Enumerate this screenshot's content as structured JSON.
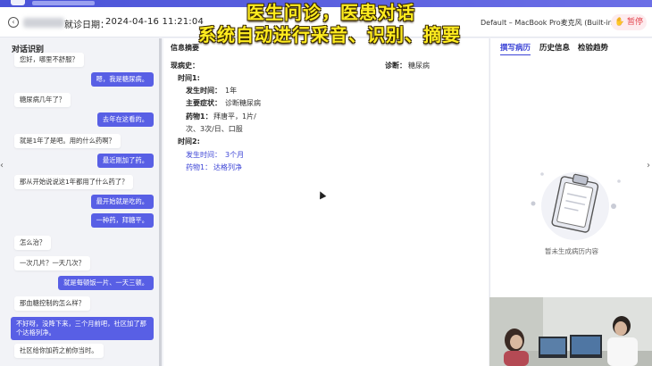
{
  "header": {
    "visit_date_label": "就诊日期：",
    "visit_date": "2024-04-16 11:21:04",
    "mic_label": "Default – MacBook Pro麦克风 (Built-in)",
    "pause_label": "暂停"
  },
  "overlay": {
    "line1": "医生问诊，医患对话",
    "line2": "系统自动进行采音、识别、摘要"
  },
  "conversation": {
    "title": "对话识别",
    "messages": [
      {
        "side": "in",
        "text": "您好，哪里不舒服？"
      },
      {
        "side": "out",
        "text": "嗯，我是糖尿病。"
      },
      {
        "side": "in",
        "text": "糖尿病几年了？"
      },
      {
        "side": "out",
        "text": "去年在这看的。"
      },
      {
        "side": "in",
        "text": "就是1年了是吧。用的什么药啊？"
      },
      {
        "side": "out",
        "text": "最近刚加了药。"
      },
      {
        "side": "in",
        "text": "那从开始说说这1年都用了什么药了？"
      },
      {
        "side": "out",
        "text": "最开始就是吃的。"
      },
      {
        "side": "out",
        "text": "一种药，拜糖平。"
      },
      {
        "side": "in",
        "text": "怎么治？"
      },
      {
        "side": "in",
        "text": "一次几片？一天几次？"
      },
      {
        "side": "out",
        "text": "就是每顿饭一片、一天三顿。"
      },
      {
        "side": "in",
        "text": "那血糖控制的怎么样？"
      },
      {
        "side": "out",
        "text": "不好呀，没降下来，三个月前吧，社区加了那个达格列净。"
      },
      {
        "side": "in",
        "text": "社区给你加药之前你当时。"
      }
    ]
  },
  "summary": {
    "title": "信息摘要",
    "history_label": "现病史：",
    "diagnosis_label": "诊断：",
    "diagnosis_value": "糖尿病",
    "time1_label": "时间1:",
    "onset_label": "发生时间：",
    "onset_value": "1年",
    "symptom_label": "主要症状：",
    "symptom_value": "诊断糖尿病",
    "drug1_label": "药物1：",
    "drug1_value": "拜唐平，1片/",
    "drug1_value2": "次、3次/日、口服",
    "time2_label": "时间2:",
    "onset2_label": "发生时间：",
    "onset2_value": "3个月",
    "drug2_label": "药物1：",
    "drug2_value": "达格列净"
  },
  "right": {
    "tabs": [
      "撰写病历",
      "历史信息",
      "检验趋势"
    ],
    "active_tab": 0,
    "empty_text": "暂未生成病历内容"
  },
  "colors": {
    "accent": "#585fe5",
    "link": "#3c44d6",
    "pause": "#e4464f",
    "overlay_text": "#ffec1f"
  }
}
